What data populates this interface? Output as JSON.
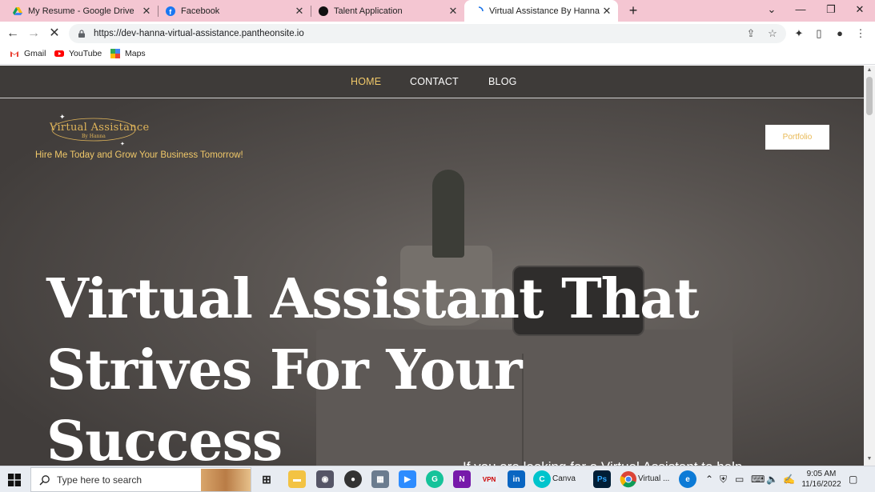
{
  "browser": {
    "tabs": [
      {
        "title": "My Resume - Google Drive",
        "icon": "google-drive-icon"
      },
      {
        "title": "Facebook",
        "icon": "facebook-icon"
      },
      {
        "title": "Talent Application",
        "icon": "black-circle-icon"
      },
      {
        "title": "Virtual Assistance By Hanna – Hir",
        "icon": "loading-spinner-icon",
        "active": true
      }
    ],
    "url": "https://dev-hanna-virtual-assistance.pantheonsite.io",
    "bookmarks": [
      "Gmail",
      "YouTube",
      "Maps"
    ]
  },
  "site": {
    "nav": [
      "HOME",
      "CONTACT",
      "BLOG"
    ],
    "logo_title": "Virtual Assistance",
    "logo_sub": "By Hanna",
    "tagline": "Hire Me Today and Grow Your Business Tomorrow!",
    "portfolio_button": "Portfolio",
    "hero_line1": "Virtual Assistant That",
    "hero_line2": "Strives For Your Success",
    "subline": "If you are looking for a Virtual Assistant to help"
  },
  "taskbar": {
    "search_placeholder": "Type here to search",
    "canva_label": "Canva",
    "chrome_label": "Virtual ...",
    "time": "9:05 AM",
    "date": "11/16/2022"
  },
  "colors": {
    "tab_strip": "#f4c6d2",
    "accent_gold": "#f0c869",
    "site_dark": "#3e3b39"
  }
}
